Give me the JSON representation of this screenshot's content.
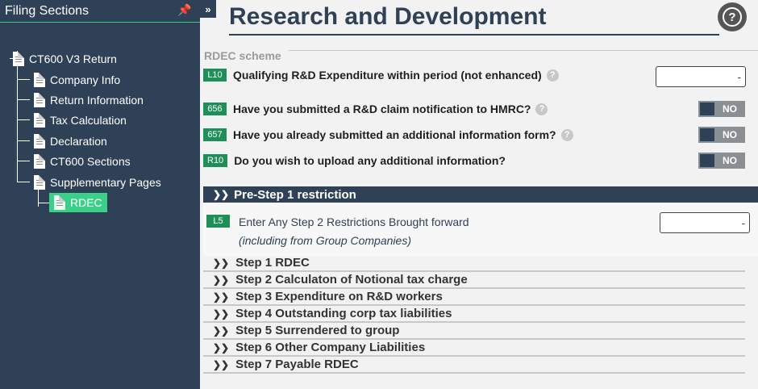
{
  "sidebar": {
    "title": "Filing Sections",
    "tree": {
      "root": "CT600 V3 Return",
      "items": [
        "Company Info",
        "Return Information",
        "Tax Calculation",
        "Declaration",
        "CT600 Sections",
        "Supplementary Pages"
      ],
      "active": "RDEC"
    }
  },
  "collapse_label": "»",
  "main": {
    "title": "Research and Development",
    "scheme_label": "RDEC scheme",
    "questions": [
      {
        "code": "L10",
        "text": "Qualifying R&D Expenditure within period (not enhanced)",
        "value": "-"
      },
      {
        "code": "656",
        "text": "Have you submitted a R&D claim notification to HMRC?",
        "toggle": "NO"
      },
      {
        "code": "657",
        "text": "Have you already submitted an additional information form?",
        "toggle": "NO"
      },
      {
        "code": "R10",
        "text": "Do you wish to upload any additional information?",
        "toggle": "NO"
      }
    ],
    "pre_step": {
      "title": "Pre-Step 1 restriction",
      "code": "L5",
      "text": "Enter Any Step 2 Restrictions Brought forward",
      "subtext": "(including from Group Companies)",
      "value": "-"
    },
    "steps": [
      "Step 1 RDEC",
      "Step 2 Calculaton of Notional tax charge",
      "Step 3 Expenditure on R&D workers",
      "Step 4 Outstanding corp tax liabilities",
      "Step 5 Surrendered to group",
      "Step 6 Other Company Liabilities",
      "Step 7 Payable RDEC"
    ]
  },
  "icons": {
    "pin": "pin-icon",
    "help": "help-icon",
    "chevron": "chevron-right-icon"
  },
  "colors": {
    "sidebar": "#2e4157",
    "accent": "#3ad08a",
    "badge": "#1f8f5a"
  }
}
